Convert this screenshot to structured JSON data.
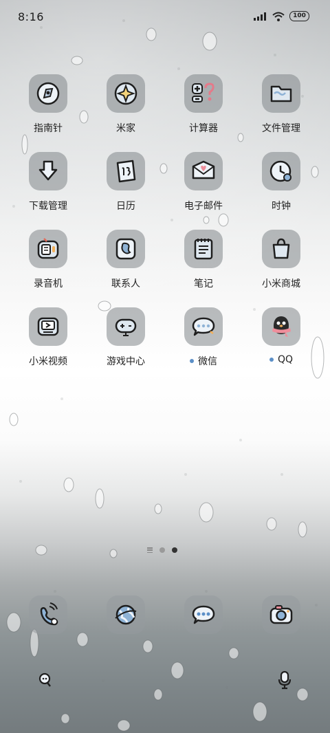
{
  "status": {
    "time": "8:16",
    "battery": "100"
  },
  "apps": [
    {
      "label": "指南针",
      "icon": "compass-icon"
    },
    {
      "label": "米家",
      "icon": "mijia-icon"
    },
    {
      "label": "计算器",
      "icon": "calculator-icon"
    },
    {
      "label": "文件管理",
      "icon": "folder-icon"
    },
    {
      "label": "下载管理",
      "icon": "download-icon"
    },
    {
      "label": "日历",
      "icon": "calendar-icon"
    },
    {
      "label": "电子邮件",
      "icon": "mail-icon"
    },
    {
      "label": "时钟",
      "icon": "clock-icon"
    },
    {
      "label": "录音机",
      "icon": "recorder-icon"
    },
    {
      "label": "联系人",
      "icon": "contacts-icon"
    },
    {
      "label": "笔记",
      "icon": "notes-icon"
    },
    {
      "label": "小米商城",
      "icon": "shopping-bag-icon"
    },
    {
      "label": "小米视频",
      "icon": "tv-icon"
    },
    {
      "label": "游戏中心",
      "icon": "gamepad-icon"
    },
    {
      "label": "微信",
      "icon": "chat-icon",
      "badge": true
    },
    {
      "label": "QQ",
      "icon": "penguin-icon",
      "badge": true
    }
  ],
  "dock": [
    {
      "icon": "phone-icon"
    },
    {
      "icon": "browser-icon"
    },
    {
      "icon": "message-icon"
    },
    {
      "icon": "camera-icon"
    }
  ],
  "pager": {
    "pages": 2,
    "active": 2
  },
  "bottom_bar": {
    "left": "search-icon",
    "right": "microphone-icon"
  },
  "colors": {
    "badge": "#5b8fc7",
    "tile": "#868a8d",
    "icon_fill": "#dfe8f0",
    "icon_stroke": "#1e1e1e"
  }
}
